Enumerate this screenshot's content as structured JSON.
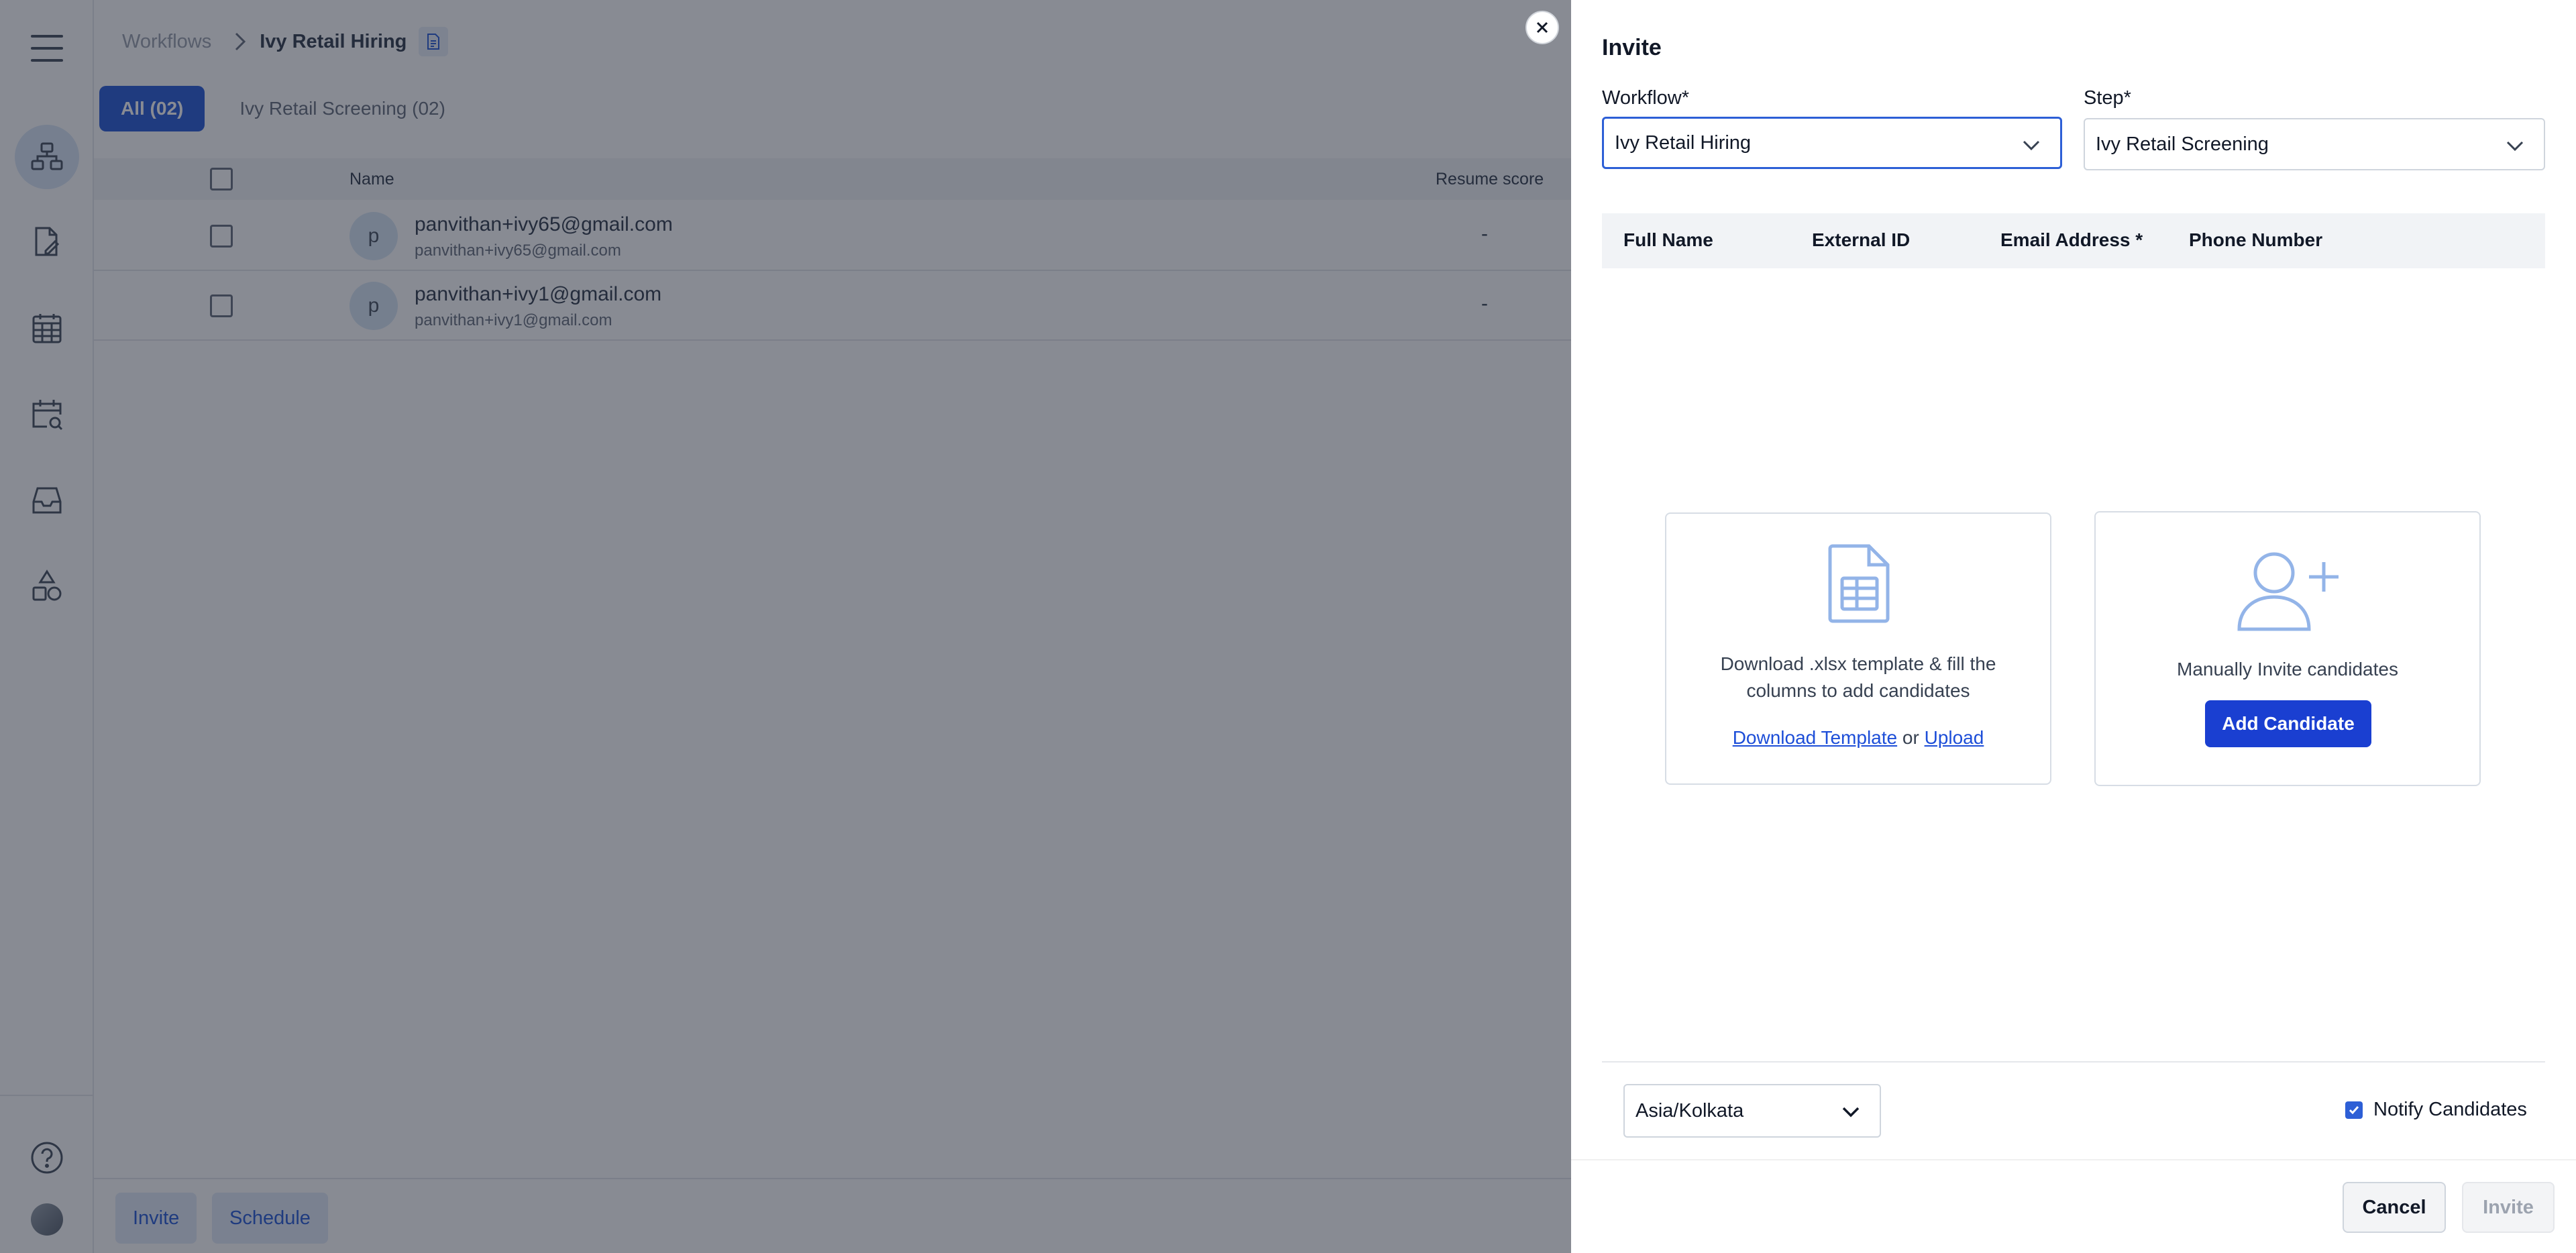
{
  "sidebar": {
    "items": [
      {
        "icon": "workflows-icon",
        "active": true
      },
      {
        "icon": "edit-document-icon",
        "active": false
      },
      {
        "icon": "calendar-grid-icon",
        "active": false
      },
      {
        "icon": "calendar-search-icon",
        "active": false
      },
      {
        "icon": "inbox-icon",
        "active": false
      },
      {
        "icon": "shapes-icon",
        "active": false
      }
    ],
    "help_icon": "help-icon"
  },
  "breadcrumb": {
    "root": "Workflows",
    "current": "Ivy Retail Hiring"
  },
  "tabs": [
    {
      "label": "All (02)",
      "active": true
    },
    {
      "label": "Ivy Retail Screening (02)",
      "active": false
    }
  ],
  "table": {
    "headers": {
      "name": "Name",
      "resume_score": "Resume score"
    },
    "rows": [
      {
        "initial": "p",
        "name": "panvithan+ivy65@gmail.com",
        "email": "panvithan+ivy65@gmail.com",
        "score": "-"
      },
      {
        "initial": "p",
        "name": "panvithan+ivy1@gmail.com",
        "email": "panvithan+ivy1@gmail.com",
        "score": "-"
      }
    ]
  },
  "footer": {
    "invite_label": "Invite",
    "schedule_label": "Schedule"
  },
  "drawer": {
    "title": "Invite",
    "workflow_label": "Workflow*",
    "workflow_value": "Ivy Retail Hiring",
    "step_label": "Step*",
    "step_value": "Ivy Retail Screening",
    "columns": [
      "Full Name",
      "External ID",
      "Email Address *",
      "Phone Number"
    ],
    "template_card": {
      "text_line1": "Download .xlsx template & fill the",
      "text_line2": "columns to add candidates",
      "download_link": "Download Template",
      "or_text": "or",
      "upload_link": "Upload"
    },
    "manual_card": {
      "text": "Manually Invite candidates",
      "button": "Add Candidate"
    },
    "timezone": "Asia/Kolkata",
    "notify_label": "Notify Candidates",
    "notify_checked": true,
    "cancel_label": "Cancel",
    "invite_label": "Invite"
  },
  "colors": {
    "primary": "#1a3fd1",
    "tab_active": "#2d5fd6",
    "overlay": "rgba(17,24,39,0.5)"
  }
}
